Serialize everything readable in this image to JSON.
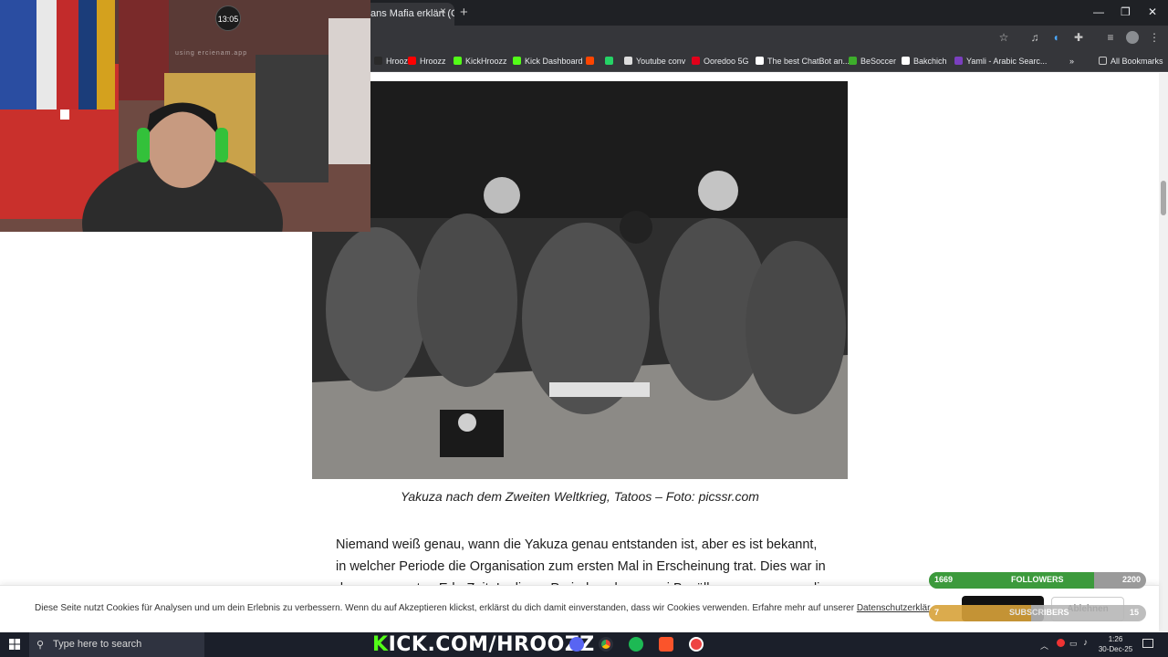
{
  "browser": {
    "tab_title": "ans Mafia erklärt (G...",
    "tab_close": "×",
    "new_tab": "+",
    "window_controls": [
      "—",
      "❐",
      "✕"
    ],
    "bookmarks": [
      {
        "label": "Hroozz",
        "color": "#2a2a2a"
      },
      {
        "label": "Hroozz",
        "color": "#ff0000"
      },
      {
        "label": "KickHroozz",
        "color": "#53fc18"
      },
      {
        "label": "Kick Dashboard",
        "color": "#53fc18"
      },
      {
        "label": "",
        "color": "#ff4500"
      },
      {
        "label": "",
        "color": "#25d366"
      },
      {
        "label": "Youtube conv",
        "color": "#dddddd"
      },
      {
        "label": "Ooredoo 5G",
        "color": "#e2001a"
      },
      {
        "label": "The best ChatBot an...",
        "color": "#ffffff"
      },
      {
        "label": "BeSoccer",
        "color": "#3dae2b"
      },
      {
        "label": "Bakchich",
        "color": "#ffffff"
      },
      {
        "label": "Yamli - Arabic Searc...",
        "color": "#7a3fbf"
      }
    ],
    "more_bookmarks": "»",
    "all_bookmarks": "All Bookmarks"
  },
  "article": {
    "caption": "Yakuza nach dem Zweiten Weltkrieg, Tatoos – Foto: picssr.com",
    "paragraph": "Niemand weiß genau, wann die Yakuza genau entstanden ist, aber es ist bekannt, in welcher Periode die Organisation zum ersten Mal in Erscheinung trat. Dies war in der sogenannten Edo-Zeit. In dieser Periode gab es zwei Bevölkerungsgruppen, die an"
  },
  "cookie": {
    "text": "Diese Seite nutzt Cookies für Analysen und um dein Erlebnis zu verbessern. Wenn du auf Akzeptieren klickst, erklärst du dich damit einverstanden, dass wir Cookies verwenden. Erfahre mehr auf unserer",
    "link": "Datenschutzerklär",
    "reject": "Ablehnen"
  },
  "overlay": {
    "webcam_clock": "13:05",
    "webcam_watermark": "using ercienam.app",
    "followers": {
      "current": "1669",
      "label": "FOLLOWERS",
      "goal": "2200",
      "progress": 0.76
    },
    "subscribers": {
      "current": "7",
      "label": "SUBSCRIBERS",
      "goal": "15",
      "progress": 0.47
    },
    "stream_url": {
      "prefix": "K",
      "rest": "ICK.COM/HROOZZ"
    }
  },
  "taskbar": {
    "search_placeholder": "Type here to search",
    "time": "1:26",
    "date": "30-Dec-25"
  }
}
